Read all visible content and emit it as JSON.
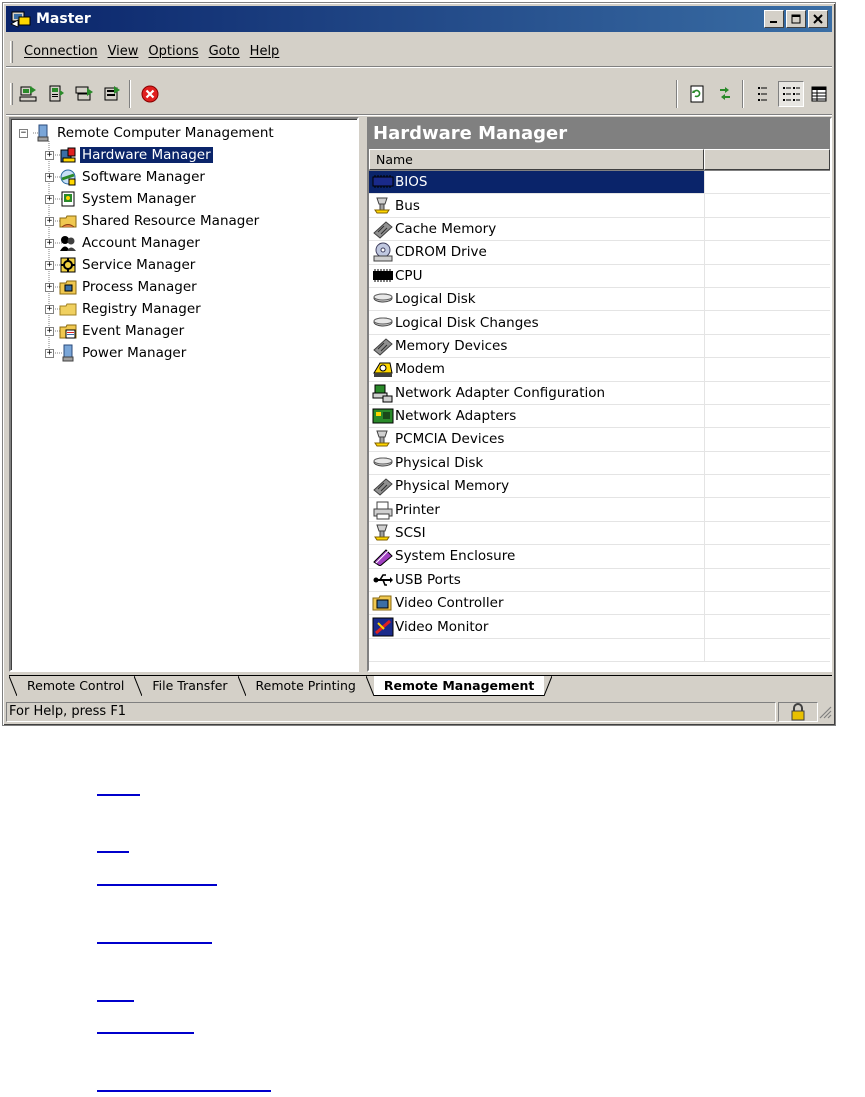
{
  "window": {
    "title": "Master"
  },
  "menu": [
    "Connection",
    "View",
    "Options",
    "Goto",
    "Help"
  ],
  "tree": {
    "root": "Remote Computer Management",
    "items": [
      {
        "label": "Hardware Manager",
        "icon": "hardware-icon",
        "selected": true
      },
      {
        "label": "Software Manager",
        "icon": "software-icon"
      },
      {
        "label": "System Manager",
        "icon": "system-icon"
      },
      {
        "label": "Shared Resource Manager",
        "icon": "shared-resource-icon"
      },
      {
        "label": "Account Manager",
        "icon": "account-icon"
      },
      {
        "label": "Service Manager",
        "icon": "service-icon"
      },
      {
        "label": "Process Manager",
        "icon": "process-icon"
      },
      {
        "label": "Registry Manager",
        "icon": "registry-icon"
      },
      {
        "label": "Event Manager",
        "icon": "event-icon"
      },
      {
        "label": "Power Manager",
        "icon": "power-icon"
      }
    ]
  },
  "right_pane": {
    "title": "Hardware Manager",
    "columns": [
      "Name",
      ""
    ],
    "rows": [
      {
        "label": "BIOS",
        "icon": "bios-chip-icon",
        "selected": true
      },
      {
        "label": "Bus",
        "icon": "bus-plug-icon"
      },
      {
        "label": "Cache Memory",
        "icon": "memory-module-icon"
      },
      {
        "label": "CDROM Drive",
        "icon": "cdrom-icon"
      },
      {
        "label": "CPU",
        "icon": "cpu-chip-icon"
      },
      {
        "label": "Logical Disk",
        "icon": "disk-icon"
      },
      {
        "label": "Logical Disk Changes",
        "icon": "disk-icon"
      },
      {
        "label": "Memory Devices",
        "icon": "memory-module-icon"
      },
      {
        "label": "Modem",
        "icon": "modem-icon"
      },
      {
        "label": "Network Adapter Configuration",
        "icon": "network-config-icon"
      },
      {
        "label": "Network Adapters",
        "icon": "network-card-icon"
      },
      {
        "label": "PCMCIA Devices",
        "icon": "bus-plug-icon"
      },
      {
        "label": "Physical Disk",
        "icon": "disk-icon"
      },
      {
        "label": "Physical Memory",
        "icon": "memory-module-icon"
      },
      {
        "label": "Printer",
        "icon": "printer-icon"
      },
      {
        "label": "SCSI",
        "icon": "bus-plug-icon"
      },
      {
        "label": "System Enclosure",
        "icon": "enclosure-icon"
      },
      {
        "label": "USB Ports",
        "icon": "usb-icon"
      },
      {
        "label": "Video Controller",
        "icon": "video-controller-icon"
      },
      {
        "label": "Video Monitor",
        "icon": "monitor-icon"
      }
    ]
  },
  "tabs": [
    {
      "label": "Remote Control"
    },
    {
      "label": "File Transfer"
    },
    {
      "label": "Remote Printing"
    },
    {
      "label": "Remote Management",
      "active": true
    }
  ],
  "status": {
    "text": "For Help, press F1"
  },
  "colors": {
    "selection": "#0a246a",
    "title_start": "#0a246a",
    "title_end": "#3a6ea5",
    "chrome": "#d4d0c8",
    "header_gray": "#808080",
    "link": "#0000cc"
  }
}
